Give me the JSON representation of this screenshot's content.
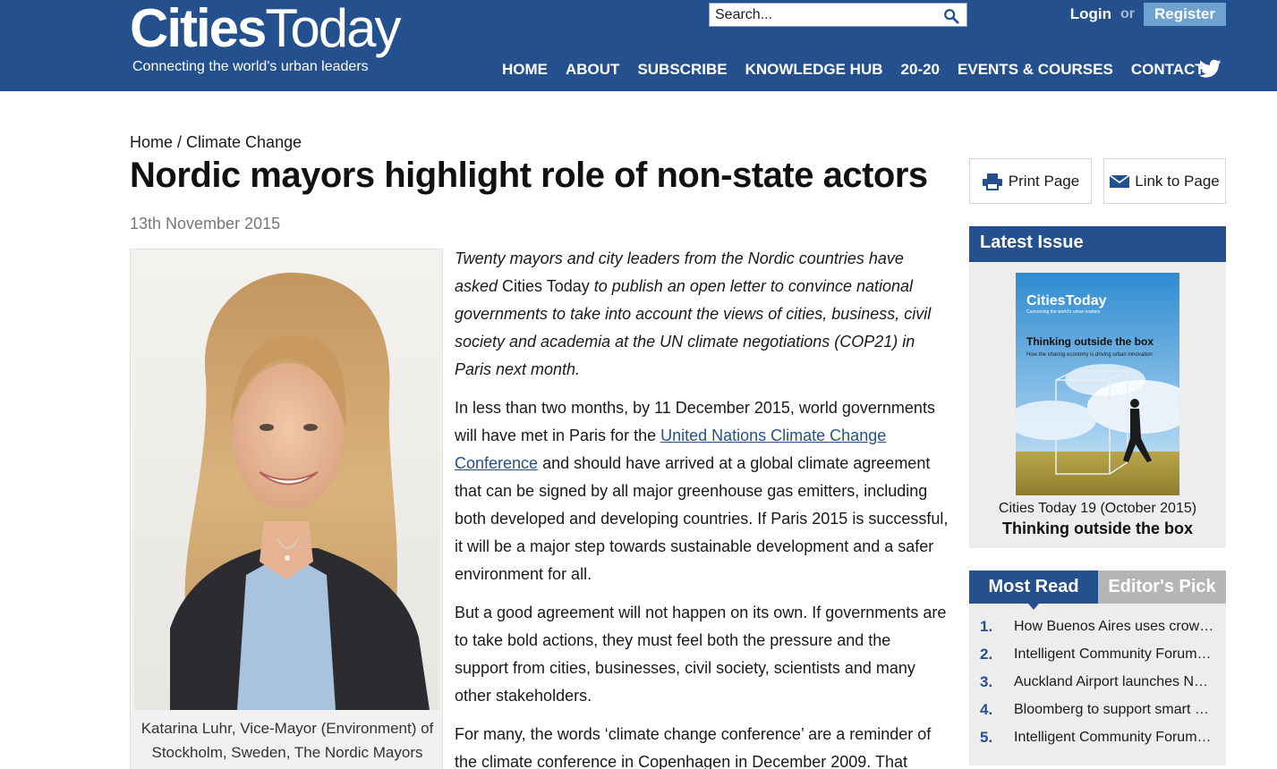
{
  "header": {
    "logo_cities": "Cities",
    "logo_today": "Today",
    "tagline": "Connecting the world's urban leaders",
    "search_placeholder": "Search...",
    "login": "Login",
    "or": "or",
    "register": "Register",
    "nav": [
      "HOME",
      "ABOUT",
      "SUBSCRIBE",
      "KNOWLEDGE HUB",
      "20-20",
      "EVENTS & COURSES",
      "CONTACT"
    ]
  },
  "breadcrumb": {
    "home": "Home",
    "separator": " / ",
    "section": "Climate Change"
  },
  "article": {
    "title": "Nordic mayors highlight role of non-state actors",
    "date": "13th November 2015",
    "caption": "Katarina Luhr, Vice-Mayor (Environment) of Stockholm, Sweden, The Nordic Mayors",
    "lead_1": "Twenty mayors and city leaders from the Nordic countries have asked ",
    "lead_pub": "Cities Today",
    "lead_2": " to publish an open letter to convince national governments to take into account the views of cities, business, civil society and academia at the UN climate negotiations (COP21) in Paris next month.",
    "p2_a": "In less than two months, by 11 December 2015, world governments will have met in Paris for the ",
    "p2_link": "United Nations Climate Change Conference",
    "p2_b": " and should have arrived at a global climate agreement that can be signed by all major greenhouse gas emitters, including both developed and developing countries. If Paris 2015 is successful, it will be a major step towards sustainable development and a safer environment for all.",
    "p3": "But a good agreement will not happen on its own. If governments are to take bold actions, they must feel both the pressure and the support from cities, businesses, civil society, scientists and many other stakeholders.",
    "p4": "For many, the words ‘climate change conference’ are a reminder of the climate conference in Copenhagen in December 2009. That"
  },
  "sidebar": {
    "print_label": "Print Page",
    "link_label": "Link to Page",
    "latest_heading": "Latest Issue",
    "cover": {
      "logo": "CitiesToday",
      "tagline": "Connecting the world's urban leaders",
      "headline": "Thinking outside the box",
      "subhead": "How the sharing economy is driving urban innovation"
    },
    "issue_name": "Cities Today 19 (October 2015)",
    "issue_title": "Thinking outside the box",
    "tabs": [
      "Most Read",
      "Editor's Pick"
    ],
    "most_read": [
      {
        "num": "1.",
        "text": "How Buenos Aires uses crowdsourcing"
      },
      {
        "num": "2.",
        "text": "Intelligent Community Forum names"
      },
      {
        "num": "3.",
        "text": "Auckland Airport launches NZ first"
      },
      {
        "num": "4.",
        "text": "Bloomberg to support smart cities"
      },
      {
        "num": "5.",
        "text": "Intelligent Community Forum reveals"
      }
    ]
  },
  "colors": {
    "brand_blue": "#24518e",
    "register_blue": "#6ea3d1",
    "tab_grey": "#b5b5b5"
  }
}
